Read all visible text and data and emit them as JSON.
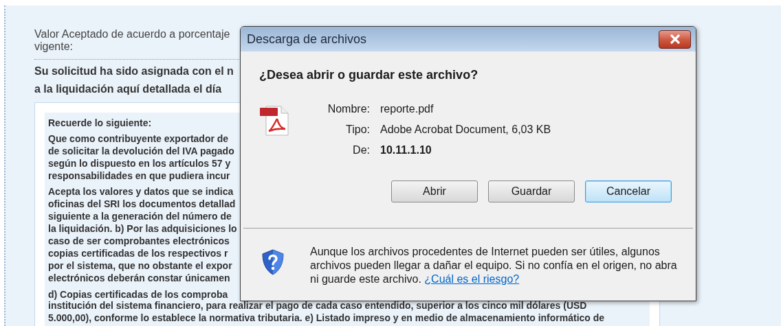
{
  "page": {
    "field_label": "Valor Aceptado de acuerdo a porcentaje vigente:",
    "notice_lines": [
      "Su solicitud ha sido asignada con el n",
      "a la liquidación aquí detallada el día"
    ],
    "reminder": {
      "title": "Recuerde lo siguiente:",
      "paragraphs": [
        [
          "Que como contribuyente exportador de",
          "de solicitar la devolución del IVA pagado",
          "según lo dispuesto en los artículos 57 y",
          "responsabilidades en que pudiera incur"
        ],
        [
          "Acepta los valores y datos que se indica",
          "oficinas del SRI los documentos detallad",
          "siguiente a la generación del número de",
          "la liquidación. b) Por las adquisiciones lo",
          "caso de ser comprobantes electrónicos",
          "copias certificadas de los respectivos r",
          "por el sistema, que no obstante el expor",
          "electrónicos deberán constar únicamen"
        ],
        [
          "d) Copias certificadas de los comproba"
        ]
      ],
      "below_dialog_lines": [
        "institución del sistema financiero, para realizar el pago de cada caso entendido, superior a los cinco mil dólares (USD",
        "5.000,00), conforme lo establece la normativa tributaria. e) Listado impreso y en medio de almacenamiento informático de"
      ]
    }
  },
  "dialog": {
    "title": "Descarga de archivos",
    "question": "¿Desea abrir o guardar este archivo?",
    "details": [
      {
        "label": "Nombre:",
        "value": "reporte.pdf",
        "bold": false
      },
      {
        "label": "Tipo:",
        "value": "Adobe Acrobat Document, 6,03 KB",
        "bold": false
      },
      {
        "label": "De:",
        "value": "10.11.1.10",
        "bold": true
      }
    ],
    "buttons": [
      {
        "label": "Abrir",
        "focused": false
      },
      {
        "label": "Guardar",
        "focused": false
      },
      {
        "label": "Cancelar",
        "focused": true
      }
    ],
    "warning": "Aunque los archivos procedentes de Internet pueden ser útiles, algunos archivos pueden llegar a dañar el equipo. Si no confía en el origen, no abra ni guarde este archivo.",
    "risk_link": "¿Cuál es el riesgo?"
  }
}
